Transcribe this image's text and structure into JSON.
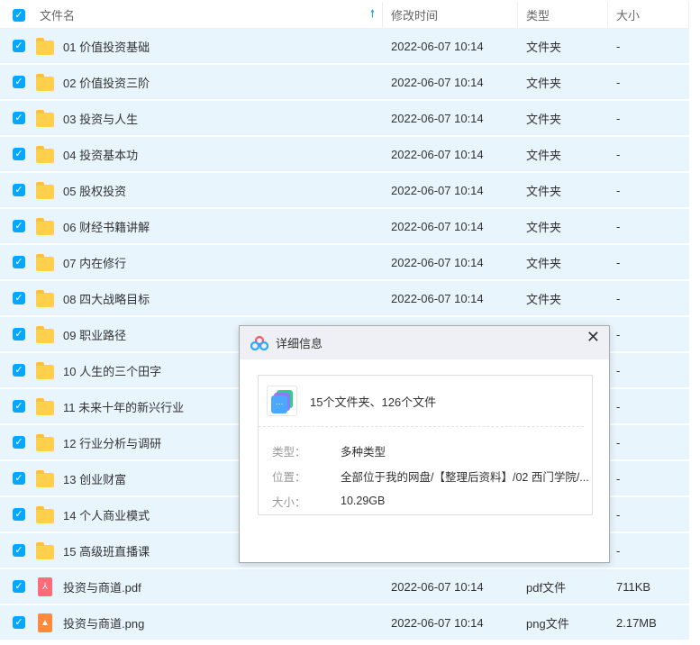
{
  "header": {
    "name": "文件名",
    "time": "修改时间",
    "type": "类型",
    "size": "大小",
    "sort_icon": "arrow-up-icon"
  },
  "rows": [
    {
      "name": "01 价值投资基础",
      "time": "2022-06-07 10:14",
      "type": "文件夹",
      "size": "-",
      "icon": "folder"
    },
    {
      "name": "02 价值投资三阶",
      "time": "2022-06-07 10:14",
      "type": "文件夹",
      "size": "-",
      "icon": "folder"
    },
    {
      "name": "03 投资与人生",
      "time": "2022-06-07 10:14",
      "type": "文件夹",
      "size": "-",
      "icon": "folder"
    },
    {
      "name": "04 投资基本功",
      "time": "2022-06-07 10:14",
      "type": "文件夹",
      "size": "-",
      "icon": "folder"
    },
    {
      "name": "05 股权投资",
      "time": "2022-06-07 10:14",
      "type": "文件夹",
      "size": "-",
      "icon": "folder"
    },
    {
      "name": "06 财经书籍讲解",
      "time": "2022-06-07 10:14",
      "type": "文件夹",
      "size": "-",
      "icon": "folder"
    },
    {
      "name": "07 内在修行",
      "time": "2022-06-07 10:14",
      "type": "文件夹",
      "size": "-",
      "icon": "folder"
    },
    {
      "name": "08 四大战略目标",
      "time": "2022-06-07 10:14",
      "type": "文件夹",
      "size": "-",
      "icon": "folder"
    },
    {
      "name": "09 职业路径",
      "time": "",
      "type": "",
      "size": "-",
      "icon": "folder"
    },
    {
      "name": "10 人生的三个田字",
      "time": "",
      "type": "",
      "size": "-",
      "icon": "folder"
    },
    {
      "name": "11 未来十年的新兴行业",
      "time": "",
      "type": "",
      "size": "-",
      "icon": "folder"
    },
    {
      "name": "12 行业分析与调研",
      "time": "",
      "type": "",
      "size": "-",
      "icon": "folder"
    },
    {
      "name": "13 创业财富",
      "time": "",
      "type": "",
      "size": "-",
      "icon": "folder"
    },
    {
      "name": "14 个人商业模式",
      "time": "",
      "type": "",
      "size": "-",
      "icon": "folder"
    },
    {
      "name": "15 高级班直播课",
      "time": "",
      "type": "",
      "size": "-",
      "icon": "folder"
    },
    {
      "name": "投资与商道.pdf",
      "time": "2022-06-07 10:14",
      "type": "pdf文件",
      "size": "711KB",
      "icon": "pdf"
    },
    {
      "name": "投资与商道.png",
      "time": "2022-06-07 10:14",
      "type": "png文件",
      "size": "2.17MB",
      "icon": "png"
    }
  ],
  "dialog": {
    "title": "详细信息",
    "summary": "15个文件夹、126个文件",
    "type_label": "类型：",
    "type_value": "多种类型",
    "location_label": "位置：",
    "location_value": "全部位于我的网盘/【整理后资料】/02 西门学院/...",
    "size_label": "大小：",
    "size_value": "10.29GB"
  },
  "colors": {
    "accent": "#06a7ff",
    "row_selected": "#e8f5fd",
    "folder": "#ffd04b",
    "pdf": "#ff6b76",
    "png": "#ff8a3d"
  }
}
